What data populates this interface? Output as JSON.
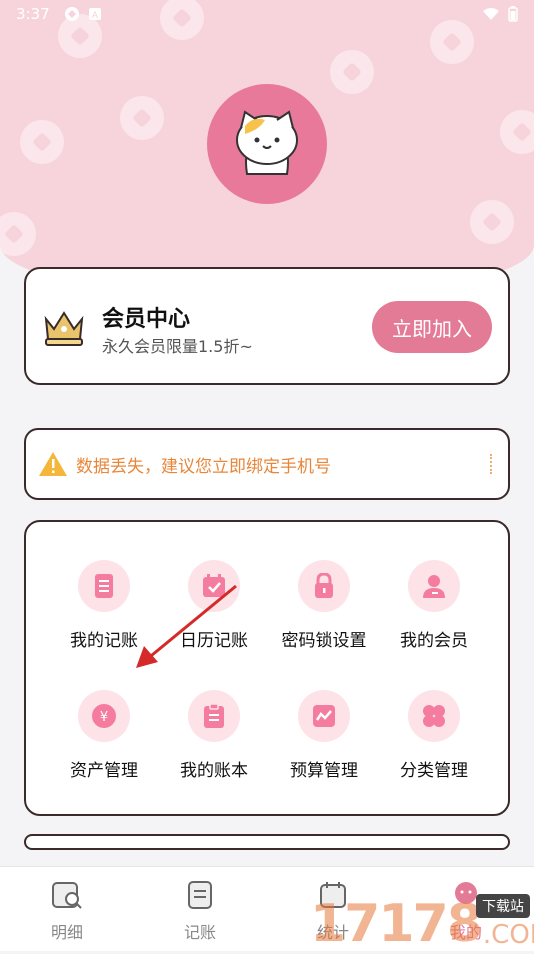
{
  "status_bar": {
    "time": "3:37"
  },
  "vip_card": {
    "title": "会员中心",
    "subtitle": "永久会员限量1.5折~",
    "join_label": "立即加入"
  },
  "notice": {
    "text": "数据丢失，建议您立即绑定手机号"
  },
  "grid": {
    "items": [
      {
        "label": "我的记账",
        "icon": "ledger-icon"
      },
      {
        "label": "日历记账",
        "icon": "calendar-check-icon"
      },
      {
        "label": "密码锁设置",
        "icon": "lock-icon"
      },
      {
        "label": "我的会员",
        "icon": "member-icon"
      },
      {
        "label": "资产管理",
        "icon": "yen-coin-icon"
      },
      {
        "label": "我的账本",
        "icon": "clipboard-icon"
      },
      {
        "label": "预算管理",
        "icon": "budget-chart-icon"
      },
      {
        "label": "分类管理",
        "icon": "category-clover-icon"
      }
    ]
  },
  "tabbar": {
    "tabs": [
      {
        "label": "明细",
        "icon": "detail-icon"
      },
      {
        "label": "记账",
        "icon": "notepad-icon"
      },
      {
        "label": "统计",
        "icon": "calendar-icon"
      },
      {
        "label": "我的",
        "icon": "profile-icon"
      }
    ]
  },
  "watermark": {
    "digits": "17178",
    "suffix": ".COM",
    "tag": "下载站"
  },
  "colors": {
    "accent": "#e37b97",
    "header_bg": "#f7d4db",
    "warning": "#e8863a",
    "icon_bg": "#fde2e8"
  }
}
